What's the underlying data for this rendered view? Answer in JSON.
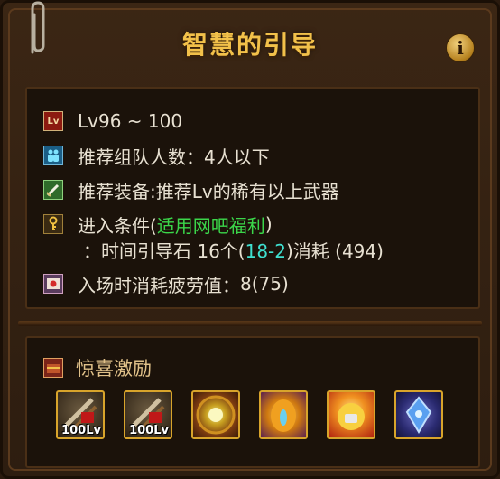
{
  "window": {
    "title": "智慧的引导"
  },
  "info_button": {
    "label": "i"
  },
  "details": {
    "level": {
      "icon_text": "Lv",
      "text": "Lv96 ~ 100"
    },
    "party": {
      "label": "推荐组队人数：",
      "value": "4人以下"
    },
    "equipment": {
      "label": "推荐装备: ",
      "value": "推荐Lv的稀有以上武器"
    },
    "entry": {
      "label": "进入条件(",
      "highlight": "适用网吧福利",
      "close": ")",
      "sub_prefix": "：时间引导石 16个(",
      "sub_highlight": "18-2",
      "sub_suffix": ")消耗 (494)"
    },
    "fatigue": {
      "label": "入场时消耗疲劳值：",
      "value": "8(75)"
    }
  },
  "rewards": {
    "title": "惊喜激励",
    "items": [
      {
        "name": "weapon-box",
        "level": "100Lv"
      },
      {
        "name": "weapon-box",
        "level": "100Lv"
      },
      {
        "name": "golden-orb",
        "level": ""
      },
      {
        "name": "amber-egg",
        "level": ""
      },
      {
        "name": "fire-orb",
        "level": ""
      },
      {
        "name": "blue-crystal",
        "level": ""
      }
    ]
  },
  "colors": {
    "title": "#f2c14a",
    "highlight_green": "#3bd64a",
    "text": "#e8e1d2"
  }
}
